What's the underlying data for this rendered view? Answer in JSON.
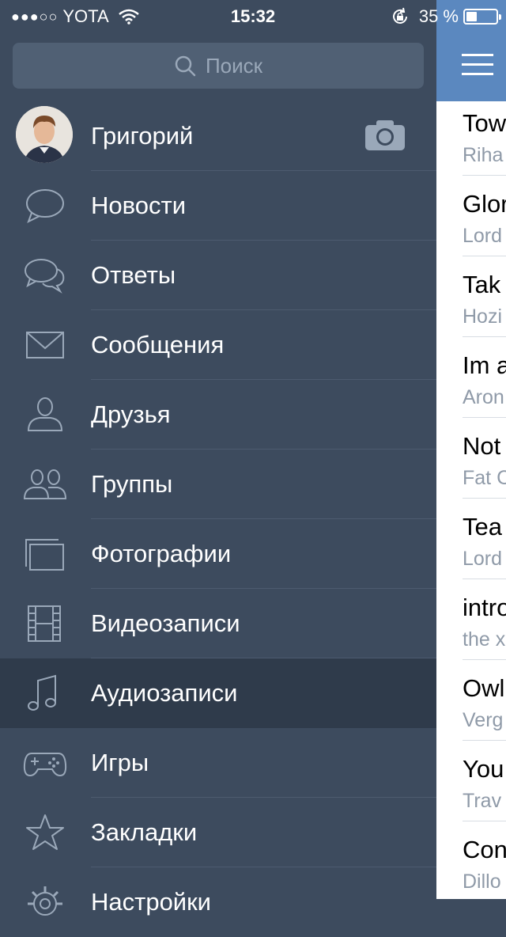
{
  "status": {
    "signal": "●●●○○",
    "carrier": "YOTA",
    "time": "15:32",
    "battery": "35 %",
    "battery_level": 0.35
  },
  "search": {
    "placeholder": "Поиск"
  },
  "profile": {
    "name": "Григорий"
  },
  "menu": [
    {
      "label": "Новости",
      "icon": "news-bubble-icon"
    },
    {
      "label": "Ответы",
      "icon": "answers-bubbles-icon"
    },
    {
      "label": "Сообщения",
      "icon": "envelope-icon"
    },
    {
      "label": "Друзья",
      "icon": "person-icon"
    },
    {
      "label": "Группы",
      "icon": "group-icon"
    },
    {
      "label": "Фотографии",
      "icon": "photos-icon"
    },
    {
      "label": "Видеозаписи",
      "icon": "film-icon"
    },
    {
      "label": "Аудиозаписи",
      "icon": "music-note-icon",
      "active": true
    },
    {
      "label": "Игры",
      "icon": "gamepad-icon"
    },
    {
      "label": "Закладки",
      "icon": "star-icon"
    },
    {
      "label": "Настройки",
      "icon": "gear-icon"
    }
  ],
  "tracks": [
    {
      "title": "Tow",
      "artist": "Riha"
    },
    {
      "title": "Glor",
      "artist": "Lord"
    },
    {
      "title": "Tak",
      "artist": "Hozi"
    },
    {
      "title": "Im a",
      "artist": "Aron"
    },
    {
      "title": "Not",
      "artist": "Fat C"
    },
    {
      "title": "Tea",
      "artist": "Lord"
    },
    {
      "title": "intro",
      "artist": "the x"
    },
    {
      "title": "Owl",
      "artist": "Verg"
    },
    {
      "title": "You",
      "artist": "Trav"
    },
    {
      "title": "Con",
      "artist": "Dillo"
    }
  ],
  "colors": {
    "sidebar": "#3d4b5e",
    "active": "#2f3b4b",
    "navbar": "#5b88bf"
  }
}
